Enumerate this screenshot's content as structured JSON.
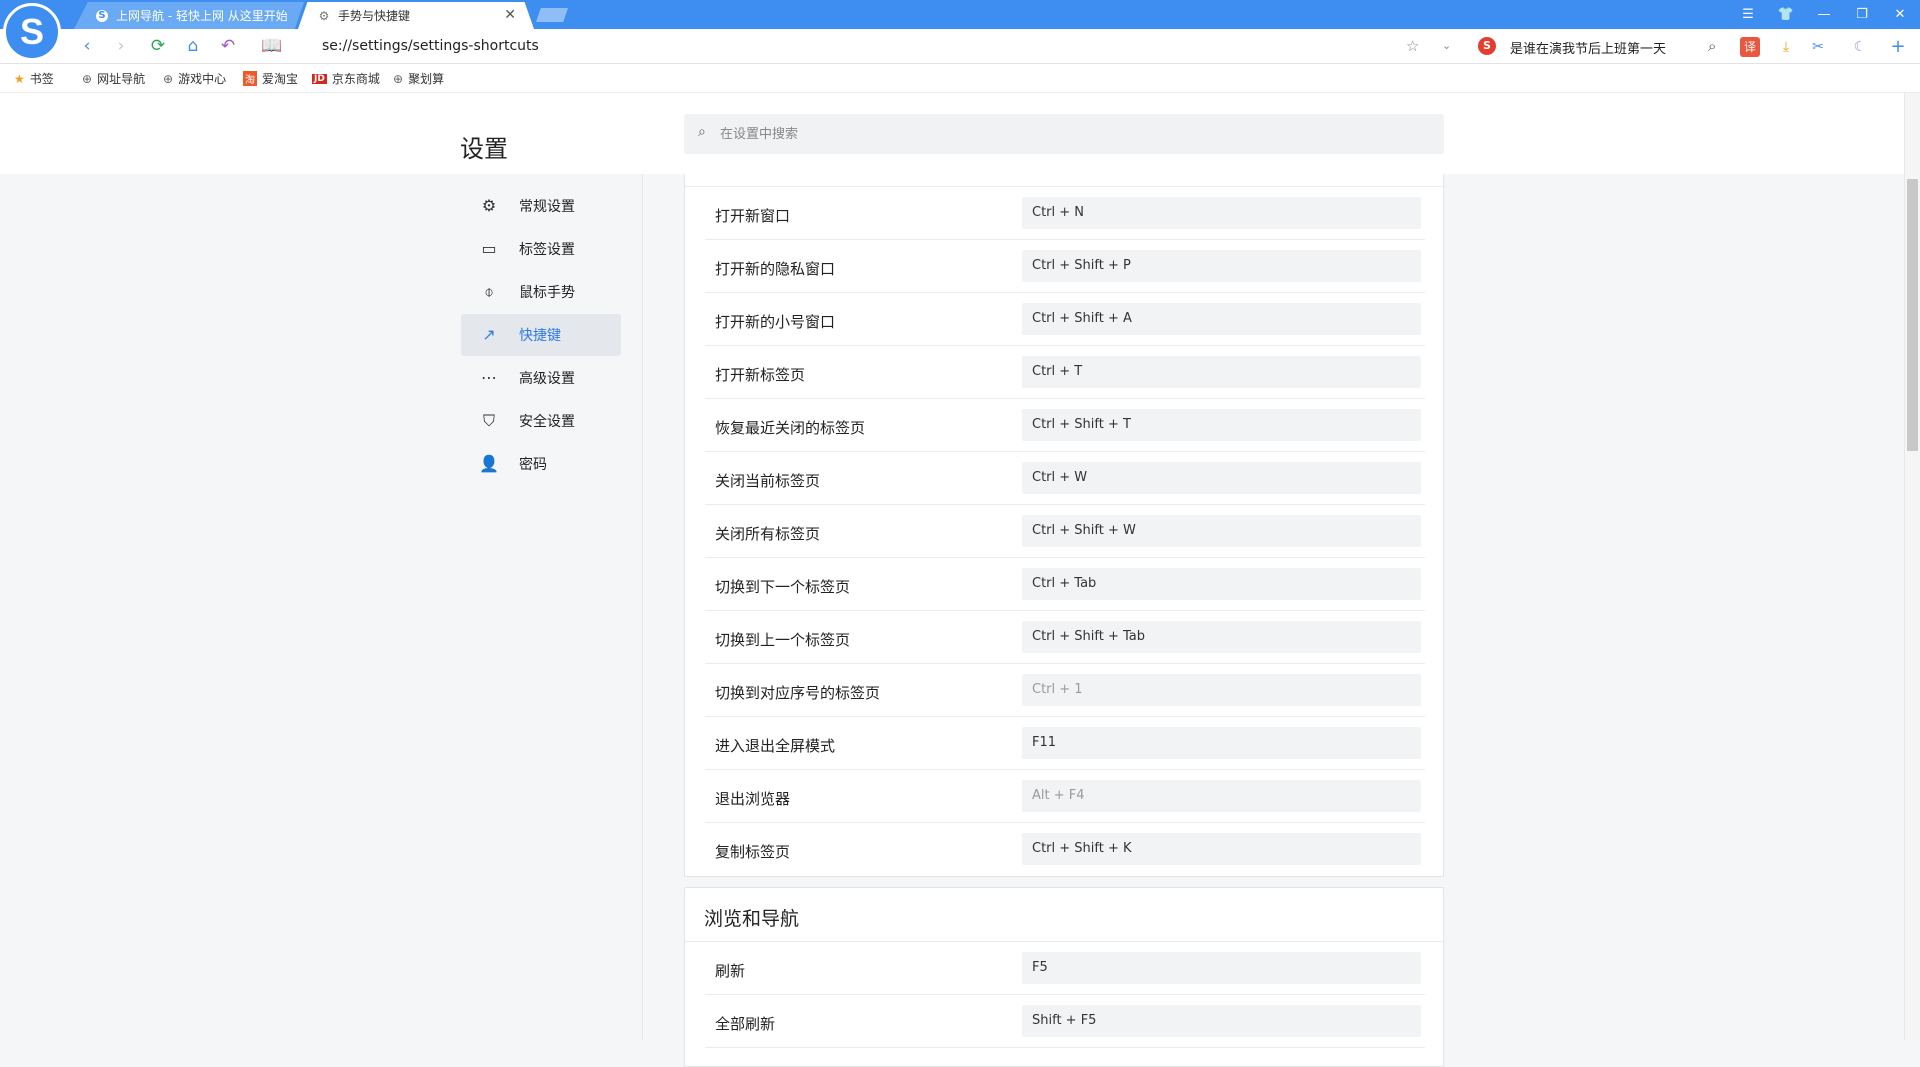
{
  "browser": {
    "logo_letter": "S",
    "tabs": [
      {
        "title": "上网导航 - 轻快上网 从这里开始",
        "icon": "sogou-icon"
      },
      {
        "title": "手势与快捷键",
        "icon": "gear-icon",
        "close": "✕"
      }
    ],
    "window_controls": [
      "☰",
      "👕",
      "—",
      "❐",
      "✕"
    ],
    "address": "se://settings/settings-shortcuts",
    "promo_text": "是谁在演我节后上班第一天",
    "bookmarks": [
      {
        "label": "书签",
        "icon": "★"
      },
      {
        "label": "网址导航",
        "icon": "⊕"
      },
      {
        "label": "游戏中心",
        "icon": "⊕"
      },
      {
        "label": "爱淘宝",
        "icon": "淘"
      },
      {
        "label": "京东商城",
        "icon": "JD"
      },
      {
        "label": "聚划算",
        "icon": "⊕"
      }
    ]
  },
  "header": {
    "title": "设置",
    "search_placeholder": "在设置中搜索"
  },
  "sidebar": {
    "items": [
      {
        "label": "常规设置",
        "icon": "⚙"
      },
      {
        "label": "标签设置",
        "icon": "▭"
      },
      {
        "label": "鼠标手势",
        "icon": "⌽"
      },
      {
        "label": "快捷键",
        "icon": "↗"
      },
      {
        "label": "高级设置",
        "icon": "⋯"
      },
      {
        "label": "安全设置",
        "icon": "⛉"
      },
      {
        "label": "密码",
        "icon": "👤"
      }
    ]
  },
  "shortcuts": [
    {
      "label": "打开新窗口",
      "key": "Ctrl + N"
    },
    {
      "label": "打开新的隐私窗口",
      "key": "Ctrl + Shift + P"
    },
    {
      "label": "打开新的小号窗口",
      "key": "Ctrl + Shift + A"
    },
    {
      "label": "打开新标签页",
      "key": "Ctrl + T"
    },
    {
      "label": "恢复最近关闭的标签页",
      "key": "Ctrl + Shift + T"
    },
    {
      "label": "关闭当前标签页",
      "key": "Ctrl + W"
    },
    {
      "label": "关闭所有标签页",
      "key": "Ctrl + Shift + W"
    },
    {
      "label": "切换到下一个标签页",
      "key": "Ctrl + Tab"
    },
    {
      "label": "切换到上一个标签页",
      "key": "Ctrl + Shift + Tab"
    },
    {
      "label": "切换到对应序号的标签页",
      "key": "Ctrl + 1"
    },
    {
      "label": "进入退出全屏模式",
      "key": "F11"
    },
    {
      "label": "退出浏览器",
      "key": "Alt + F4"
    },
    {
      "label": "复制标签页",
      "key": "Ctrl + Shift + K"
    }
  ],
  "browse_section": {
    "title": "浏览和导航",
    "rows": [
      {
        "label": "刷新",
        "key": "F5"
      },
      {
        "label": "全部刷新",
        "key": "Shift + F5"
      }
    ]
  }
}
